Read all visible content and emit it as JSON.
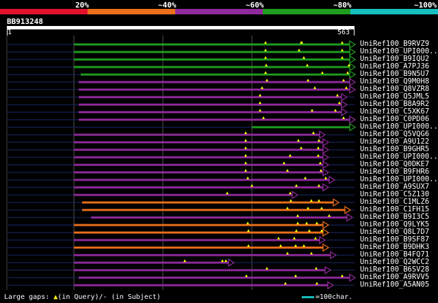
{
  "legend": {
    "segments": [
      {
        "label": "",
        "color": "#e3122c"
      },
      {
        "label": "20%",
        "color": "#ec6f1b"
      },
      {
        "label": "~40%",
        "color": "#8f2a9c"
      },
      {
        "label": "~60%",
        "color": "#1f9e1f"
      },
      {
        "label": "~80%",
        "color": "#17c0c0"
      }
    ],
    "end_label": "~100%"
  },
  "query": {
    "id": "BB913248",
    "start": "1",
    "end": "563"
  },
  "hits": [
    {
      "name": "UniRef100_B9RVZ9",
      "color": "#1f9e1f",
      "start": 108,
      "end": 512,
      "gaps": [
        388,
        440,
        441,
        500
      ]
    },
    {
      "name": "UniRef100_UPI000...",
      "color": "#1f9e1f",
      "start": 108,
      "end": 512,
      "gaps": [
        388,
        437,
        500
      ]
    },
    {
      "name": "UniRef100_B9IQU2",
      "color": "#1f9e1f",
      "start": 108,
      "end": 512,
      "gaps": [
        388,
        444,
        500
      ]
    },
    {
      "name": "UniRef100_A7PJ36",
      "color": "#1f9e1f",
      "start": 108,
      "end": 512,
      "gaps": [
        389,
        449,
        510
      ]
    },
    {
      "name": "UniRef100_B9N5U7",
      "color": "#1f9e1f",
      "start": 118,
      "end": 512,
      "gaps": [
        388,
        471,
        508
      ]
    },
    {
      "name": "UniRef100_Q9M0H8",
      "color": "#8f2a9c",
      "start": 115,
      "end": 512,
      "gaps": [
        390,
        450,
        502
      ]
    },
    {
      "name": "UniRef100_Q8VZR8",
      "color": "#8f2a9c",
      "start": 115,
      "end": 512,
      "gaps": [
        383,
        460,
        506
      ]
    },
    {
      "name": "UniRef100_Q5JML5",
      "color": "#8f2a9c",
      "start": 115,
      "end": 500,
      "gaps": [
        380,
        493
      ]
    },
    {
      "name": "UniRef100_B8A9R2",
      "color": "#8f2a9c",
      "start": 115,
      "end": 500,
      "gaps": [
        380,
        496
      ]
    },
    {
      "name": "UniRef100_C5XK67",
      "color": "#8f2a9c",
      "start": 115,
      "end": 500,
      "gaps": [
        380,
        456,
        490
      ]
    },
    {
      "name": "UniRef100_C0PD06",
      "color": "#8f2a9c",
      "start": 115,
      "end": 512,
      "gaps": [
        385,
        502
      ]
    },
    {
      "name": "UniRef100_UPI000...",
      "color": "#1f9e1f",
      "start": 368,
      "end": 512,
      "gaps": []
    },
    {
      "name": "UniRef100_Q5VQG6",
      "color": "#8f2a9c",
      "start": 108,
      "end": 468,
      "gaps": [
        359,
        458
      ]
    },
    {
      "name": "UniRef100_A9U122",
      "color": "#8f2a9c",
      "start": 108,
      "end": 473,
      "gaps": [
        359,
        436,
        466
      ]
    },
    {
      "name": "UniRef100_B9GHR5",
      "color": "#8f2a9c",
      "start": 108,
      "end": 473,
      "gaps": [
        359,
        440,
        465
      ]
    },
    {
      "name": "UniRef100_UPI000...",
      "color": "#8f2a9c",
      "start": 108,
      "end": 473,
      "gaps": [
        359,
        424,
        465
      ]
    },
    {
      "name": "UniRef100_Q0DKE7",
      "color": "#8f2a9c",
      "start": 108,
      "end": 473,
      "gaps": [
        359,
        415,
        468
      ]
    },
    {
      "name": "UniRef100_B9FHR6",
      "color": "#8f2a9c",
      "start": 108,
      "end": 473,
      "gaps": [
        359,
        420,
        469
      ]
    },
    {
      "name": "UniRef100_UPI000...",
      "color": "#8f2a9c",
      "start": 108,
      "end": 482,
      "gaps": [
        362,
        446,
        476
      ]
    },
    {
      "name": "UniRef100_A9SUX7",
      "color": "#8f2a9c",
      "start": 108,
      "end": 473,
      "gaps": [
        368,
        433,
        466
      ]
    },
    {
      "name": "UniRef100_C5Z130",
      "color": "#8f2a9c",
      "start": 108,
      "end": 428,
      "gaps": [
        332,
        424
      ]
    },
    {
      "name": "UniRef100_C1MLZ6",
      "color": "#ec6f1b",
      "start": 120,
      "end": 488,
      "gaps": [
        425,
        455,
        466
      ]
    },
    {
      "name": "UniRef100_C1FH15",
      "color": "#ec6f1b",
      "start": 120,
      "end": 505,
      "gaps": [
        420,
        450,
        470
      ]
    },
    {
      "name": "UniRef100_B9I3C5",
      "color": "#8f2a9c",
      "start": 133,
      "end": 508,
      "gaps": [
        435,
        481
      ]
    },
    {
      "name": "UniRef100_Q9LYK5",
      "color": "#ec6f1b",
      "start": 108,
      "end": 473,
      "gaps": [
        362,
        435,
        448,
        463
      ]
    },
    {
      "name": "UniRef100_Q8L7D7",
      "color": "#ec6f1b",
      "start": 108,
      "end": 473,
      "gaps": [
        363,
        433,
        452,
        470
      ]
    },
    {
      "name": "UniRef100_B9SF87",
      "color": "#8f2a9c",
      "start": 108,
      "end": 468,
      "gaps": [
        407,
        430,
        461
      ]
    },
    {
      "name": "UniRef100_B9DHK3",
      "color": "#ec6f1b",
      "start": 108,
      "end": 473,
      "gaps": [
        363,
        410,
        432,
        444
      ]
    },
    {
      "name": "UniRef100_B4FQ71",
      "color": "#8f2a9c",
      "start": 108,
      "end": 484,
      "gaps": [
        420,
        455
      ]
    },
    {
      "name": "UniRef100_Q2WCC2",
      "color": "#8f2a9c",
      "start": 108,
      "end": 335,
      "gaps": [
        270,
        325,
        330
      ]
    },
    {
      "name": "UniRef100_B6SV28",
      "color": "#8f2a9c",
      "start": 108,
      "end": 476,
      "gaps": [
        390,
        462
      ]
    },
    {
      "name": "UniRef100_A9RVV5",
      "color": "#8f2a9c",
      "start": 115,
      "end": 512,
      "gaps": [
        360,
        432,
        500
      ]
    },
    {
      "name": "UniRef100_A5AN05",
      "color": "#8f2a9c",
      "start": 108,
      "end": 480,
      "gaps": [
        417,
        463
      ]
    }
  ],
  "footer": {
    "gaps_text_prefix": "Large gaps: ",
    "gap_marker": "▲",
    "gaps_text_suffix": "(in Query)/- (in Subject)",
    "scale_text": "=100char."
  }
}
